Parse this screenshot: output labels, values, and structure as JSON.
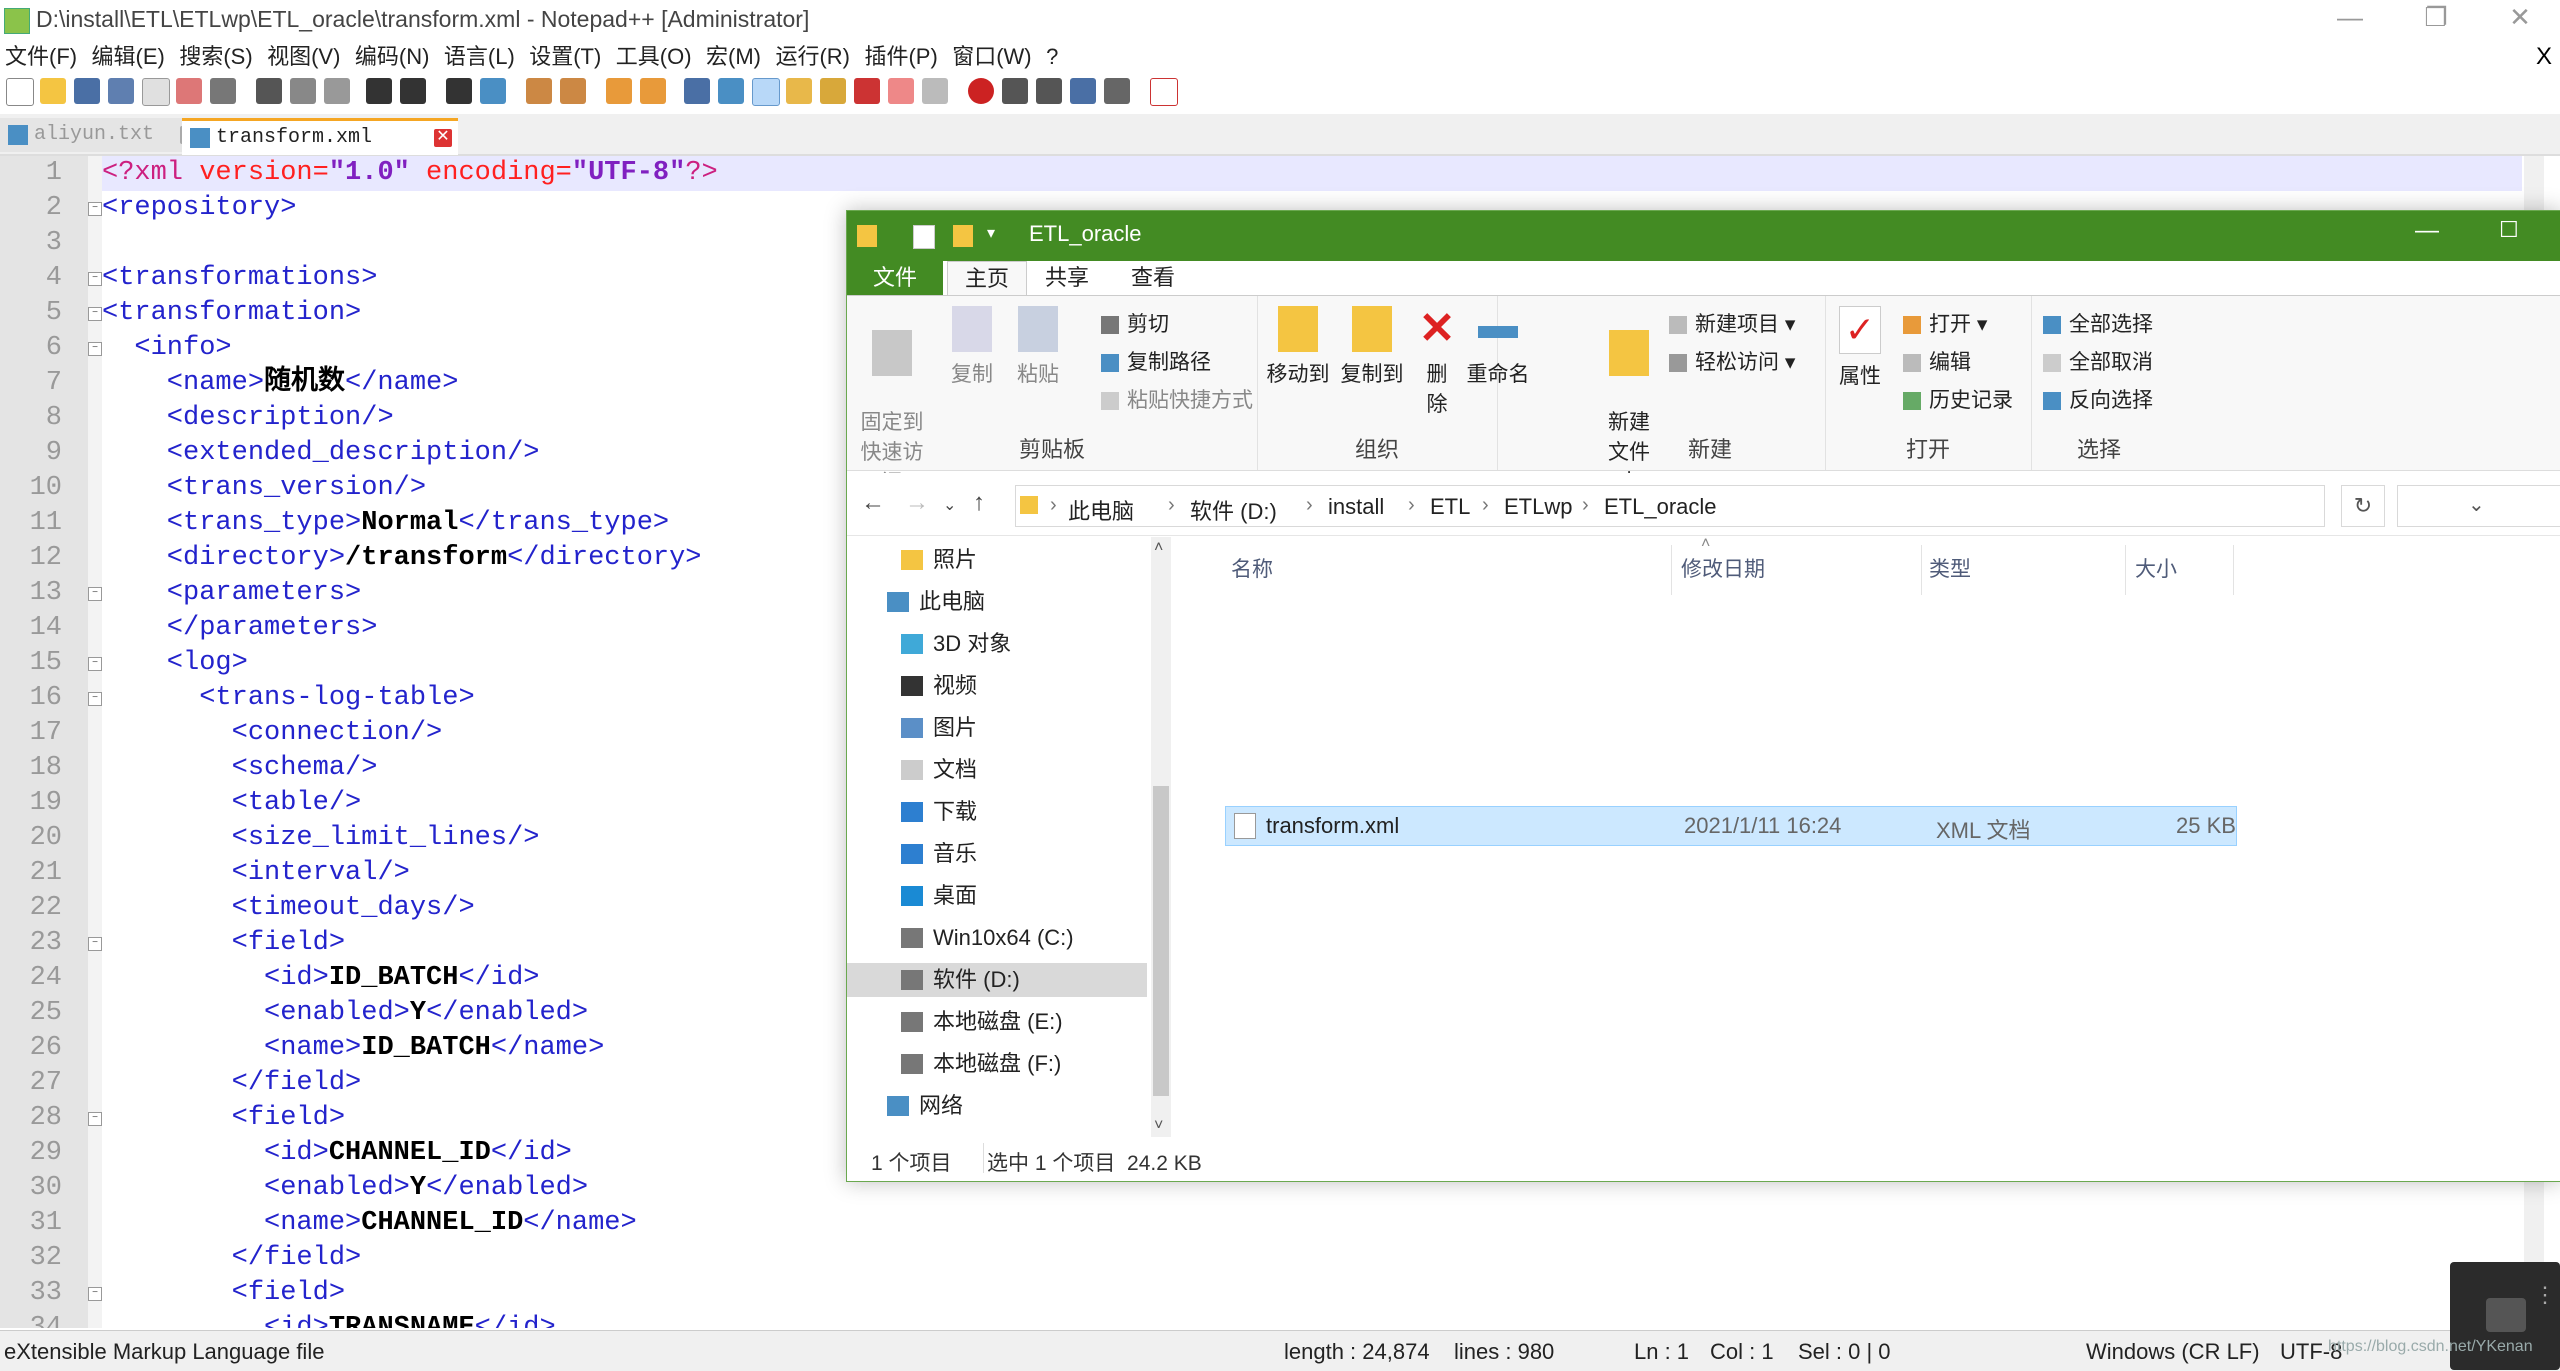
{
  "npp": {
    "title": "D:\\install\\ETL\\ETLwp\\ETL_oracle\\transform.xml - Notepad++ [Administrator]",
    "menu": [
      "文件(F)",
      "编辑(E)",
      "搜索(S)",
      "视图(V)",
      "编码(N)",
      "语言(L)",
      "设置(T)",
      "工具(O)",
      "宏(M)",
      "运行(R)",
      "插件(P)",
      "窗口(W)",
      "?"
    ],
    "menu_close": "X",
    "tabs": [
      {
        "label": "aliyun.txt",
        "active": false
      },
      {
        "label": "transform.xml",
        "active": true
      }
    ],
    "lines": [
      [
        {
          "c": "pi",
          "t": "<?xml "
        },
        {
          "c": "a",
          "t": "version="
        },
        {
          "c": "v",
          "t": "\"1.0\""
        },
        {
          "c": "a",
          "t": " encoding="
        },
        {
          "c": "v",
          "t": "\"UTF-8\""
        },
        {
          "c": "pi",
          "t": "?>"
        }
      ],
      [
        {
          "c": "t",
          "t": "<repository>"
        }
      ],
      [],
      [
        {
          "c": "t",
          "t": "<transformations>"
        }
      ],
      [
        {
          "c": "t",
          "t": "<transformation>"
        }
      ],
      [
        {
          "c": "t",
          "t": "  <info>"
        }
      ],
      [
        {
          "c": "t",
          "t": "    <name>"
        },
        {
          "c": "tx",
          "t": "随机数"
        },
        {
          "c": "t",
          "t": "</name>"
        }
      ],
      [
        {
          "c": "t",
          "t": "    <description/>"
        }
      ],
      [
        {
          "c": "t",
          "t": "    <extended_description/>"
        }
      ],
      [
        {
          "c": "t",
          "t": "    <trans_version/>"
        }
      ],
      [
        {
          "c": "t",
          "t": "    <trans_type>"
        },
        {
          "c": "tx",
          "t": "Normal"
        },
        {
          "c": "t",
          "t": "</trans_type>"
        }
      ],
      [
        {
          "c": "t",
          "t": "    <directory>"
        },
        {
          "c": "tx",
          "t": "/transform"
        },
        {
          "c": "t",
          "t": "</directory>"
        }
      ],
      [
        {
          "c": "t",
          "t": "    <parameters>"
        }
      ],
      [
        {
          "c": "t",
          "t": "    </parameters>"
        }
      ],
      [
        {
          "c": "t",
          "t": "    <log>"
        }
      ],
      [
        {
          "c": "t",
          "t": "      <trans-log-table>"
        }
      ],
      [
        {
          "c": "t",
          "t": "        <connection/>"
        }
      ],
      [
        {
          "c": "t",
          "t": "        <schema/>"
        }
      ],
      [
        {
          "c": "t",
          "t": "        <table/>"
        }
      ],
      [
        {
          "c": "t",
          "t": "        <size_limit_lines/>"
        }
      ],
      [
        {
          "c": "t",
          "t": "        <interval/>"
        }
      ],
      [
        {
          "c": "t",
          "t": "        <timeout_days/>"
        }
      ],
      [
        {
          "c": "t",
          "t": "        <field>"
        }
      ],
      [
        {
          "c": "t",
          "t": "          <id>"
        },
        {
          "c": "tx",
          "t": "ID_BATCH"
        },
        {
          "c": "t",
          "t": "</id>"
        }
      ],
      [
        {
          "c": "t",
          "t": "          <enabled>"
        },
        {
          "c": "tx",
          "t": "Y"
        },
        {
          "c": "t",
          "t": "</enabled>"
        }
      ],
      [
        {
          "c": "t",
          "t": "          <name>"
        },
        {
          "c": "tx",
          "t": "ID_BATCH"
        },
        {
          "c": "t",
          "t": "</name>"
        }
      ],
      [
        {
          "c": "t",
          "t": "        </field>"
        }
      ],
      [
        {
          "c": "t",
          "t": "        <field>"
        }
      ],
      [
        {
          "c": "t",
          "t": "          <id>"
        },
        {
          "c": "tx",
          "t": "CHANNEL_ID"
        },
        {
          "c": "t",
          "t": "</id>"
        }
      ],
      [
        {
          "c": "t",
          "t": "          <enabled>"
        },
        {
          "c": "tx",
          "t": "Y"
        },
        {
          "c": "t",
          "t": "</enabled>"
        }
      ],
      [
        {
          "c": "t",
          "t": "          <name>"
        },
        {
          "c": "tx",
          "t": "CHANNEL_ID"
        },
        {
          "c": "t",
          "t": "</name>"
        }
      ],
      [
        {
          "c": "t",
          "t": "        </field>"
        }
      ],
      [
        {
          "c": "t",
          "t": "        <field>"
        }
      ],
      [
        {
          "c": "t",
          "t": "          <id>"
        },
        {
          "c": "tx",
          "t": "TRANSNAME"
        },
        {
          "c": "t",
          "t": "</id>"
        }
      ]
    ],
    "status": {
      "filetype": "eXtensible Markup Language file",
      "length": "length : 24,874",
      "lines": "lines : 980",
      "ln": "Ln : 1",
      "col": "Col : 1",
      "sel": "Sel : 0 | 0",
      "eol": "Windows (CR LF)",
      "encoding": "UTF-8"
    }
  },
  "explorer": {
    "title": "ETL_oracle",
    "ribbon_tabs": [
      "文件",
      "主页",
      "共享",
      "查看"
    ],
    "clipboard": {
      "pin": "固定到\n快速访问",
      "copy": "复制",
      "paste": "粘贴",
      "cut": "剪切",
      "copy_path": "复制路径",
      "paste_shortcut": "粘贴快捷方式",
      "label": "剪贴板"
    },
    "organize": {
      "move_to": "移动到",
      "copy_to": "复制到",
      "delete": "删除",
      "rename": "重命名",
      "label": "组织"
    },
    "new": {
      "new_folder": "新建\n文件夹",
      "new_item": "新建项目",
      "easy_access": "轻松访问",
      "label": "新建"
    },
    "open": {
      "properties": "属性",
      "open": "打开",
      "edit": "编辑",
      "history": "历史记录",
      "label": "打开"
    },
    "select": {
      "select_all": "全部选择",
      "select_none": "全部取消",
      "invert": "反向选择",
      "label": "选择"
    },
    "breadcrumbs": [
      "此电脑",
      "软件 (D:)",
      "install",
      "ETL",
      "ETLwp",
      "ETL_oracle"
    ],
    "nav": [
      {
        "label": "照片",
        "icon": "folder-icon",
        "indent": 1
      },
      {
        "label": "此电脑",
        "icon": "computer-icon",
        "indent": 0
      },
      {
        "label": "3D 对象",
        "icon": "3d-objects-icon",
        "indent": 1
      },
      {
        "label": "视频",
        "icon": "video-icon",
        "indent": 1
      },
      {
        "label": "图片",
        "icon": "pictures-icon",
        "indent": 1
      },
      {
        "label": "文档",
        "icon": "documents-icon",
        "indent": 1
      },
      {
        "label": "下载",
        "icon": "download-icon",
        "indent": 1
      },
      {
        "label": "音乐",
        "icon": "music-icon",
        "indent": 1
      },
      {
        "label": "桌面",
        "icon": "desktop-icon",
        "indent": 1
      },
      {
        "label": "Win10x64 (C:)",
        "icon": "drive-icon",
        "indent": 1
      },
      {
        "label": "软件 (D:)",
        "icon": "drive-icon",
        "indent": 1,
        "selected": true
      },
      {
        "label": "本地磁盘 (E:)",
        "icon": "drive-icon",
        "indent": 1
      },
      {
        "label": "本地磁盘 (F:)",
        "icon": "drive-icon",
        "indent": 1
      },
      {
        "label": "网络",
        "icon": "network-icon",
        "indent": 0
      }
    ],
    "columns": [
      "名称",
      "修改日期",
      "类型",
      "大小"
    ],
    "files": [
      {
        "name": "transform.xml",
        "modified": "2021/1/11 16:24",
        "type": "XML 文档",
        "size": "25 KB"
      }
    ],
    "status": {
      "count": "1 个项目",
      "selected": "选中 1 个项目  24.2 KB"
    }
  },
  "watermark": "https://blog.csdn.net/YKenan"
}
